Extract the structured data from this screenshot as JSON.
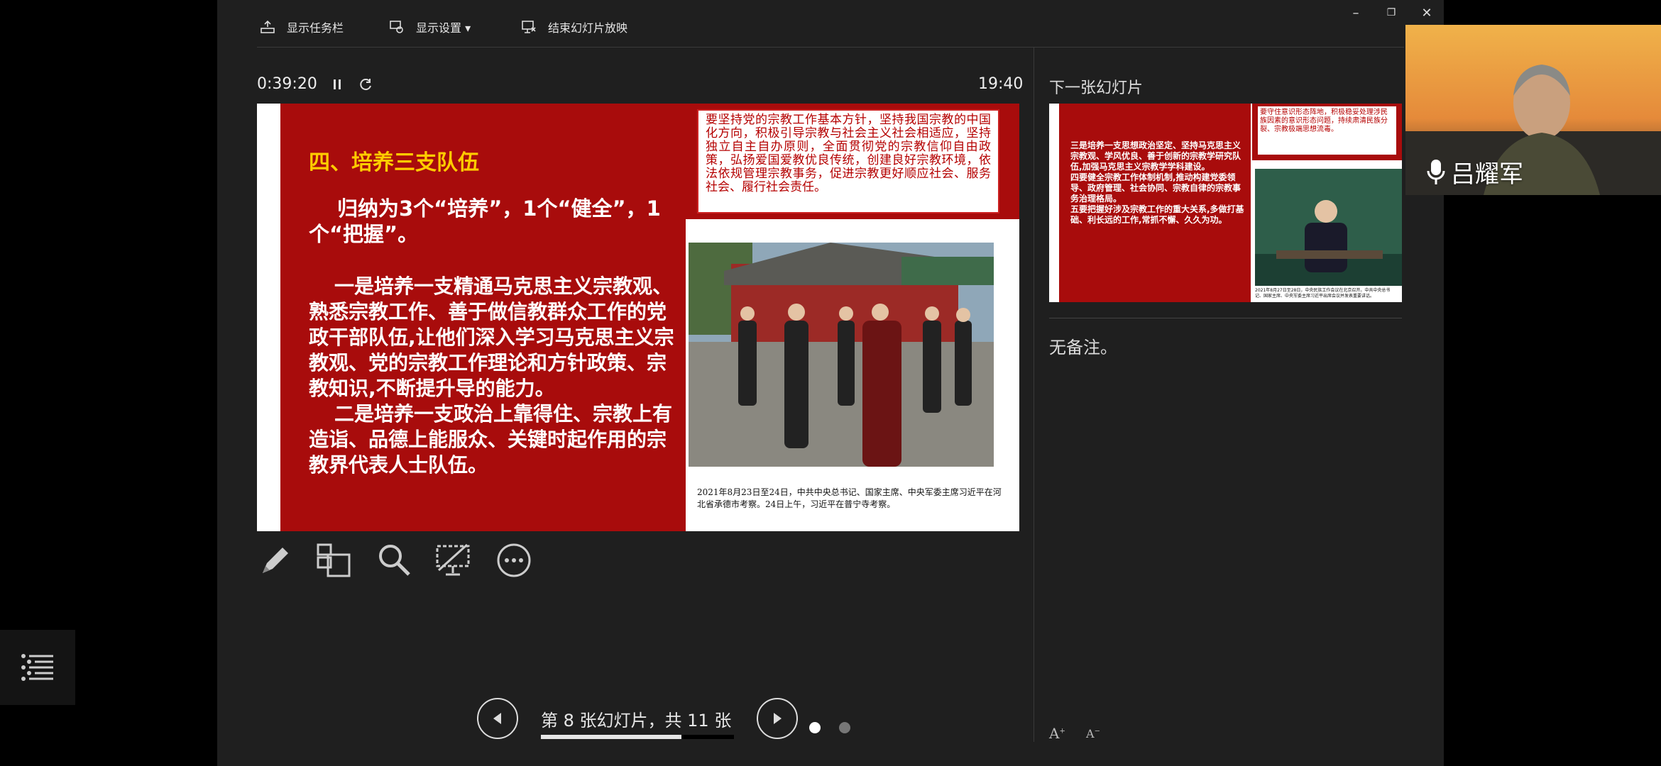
{
  "toolbar": {
    "show_taskbar": "显示任务栏",
    "display_settings": "显示设置 ▾",
    "end_slideshow": "结束幻灯片放映"
  },
  "timer": "0:39:20",
  "clock": "19:40",
  "current_slide": {
    "heading": "四、培养三支队伍",
    "summary": "归纳为3个“培养”，1个“健全”，1个“把握”。",
    "paragraphs": [
      "一是培养一支精通马克思主义宗教观、熟悉宗教工作、善于做信教群众工作的党政干部队伍,让他们深入学习马克思主义宗教观、党的宗教工作理论和方针政策、宗教知识,不断提升导的能力。",
      "二是培养一支政治上靠得住、宗教上有造诣、品德上能服众、关键时起作用的宗教界代表人士队伍。"
    ],
    "quote": "要坚持党的宗教工作基本方针，坚持我国宗教的中国化方向，积极引导宗教与社会主义社会相适应，坚持独立自主自办原则，全面贯彻党的宗教信仰自由政策，弘扬爱国爱教优良传统，创建良好宗教环境，依法依规管理宗教事务，促进宗教更好顺应社会、服务社会、履行社会责任。",
    "caption": "2021年8月23日至24日，中共中央总书记、国家主席、中央军委主席习近平在河北省承德市考察。24日上午，习近平在普宁寺考察。"
  },
  "next_slide": {
    "label": "下一张幻灯片",
    "text": "三是培养一支思想政治坚定、坚持马克思主义宗教观、学风优良、善于创新的宗教学研究队伍,加强马克思主义宗教学学科建设。\n四要健全宗教工作体制机制,推动构建党委领导、政府管理、社会协同、宗教自律的宗教事务治理格局。\n五要把握好涉及宗教工作的重大关系,多做打基础、利长远的工作,常抓不懈、久久为功。",
    "quote": "要守住意识形态阵地，积极稳妥处理涉民族因素的意识形态问题，持续肃清民族分裂、宗教极端思想流毒。",
    "caption": "2021年8月27日至28日，中央民族工作会议在北京召开。中共中央总书记、国家主席、中央军委主席习近平出席会议并发表重要讲话。"
  },
  "notes": "无备注。",
  "navigation": {
    "counter": "第 8 张幻灯片，共 11 张",
    "progress": 0.727
  },
  "font_buttons": {
    "increase": "A",
    "decrease": "A"
  },
  "video": {
    "speaker": "吕耀军"
  },
  "icons": {
    "taskbar": "taskbar-icon",
    "display": "display-settings-icon",
    "end": "end-slideshow-icon",
    "pen": "pen-icon",
    "grid": "see-all-slides-icon",
    "zoom": "zoom-icon",
    "blank": "black-screen-icon",
    "more": "more-options-icon",
    "outline": "outline-menu-icon",
    "mic": "microphone-icon"
  },
  "colors": {
    "slide_red": "#a80c0c",
    "heading_yellow": "#ffcc00",
    "background": "#1f1f1f"
  }
}
